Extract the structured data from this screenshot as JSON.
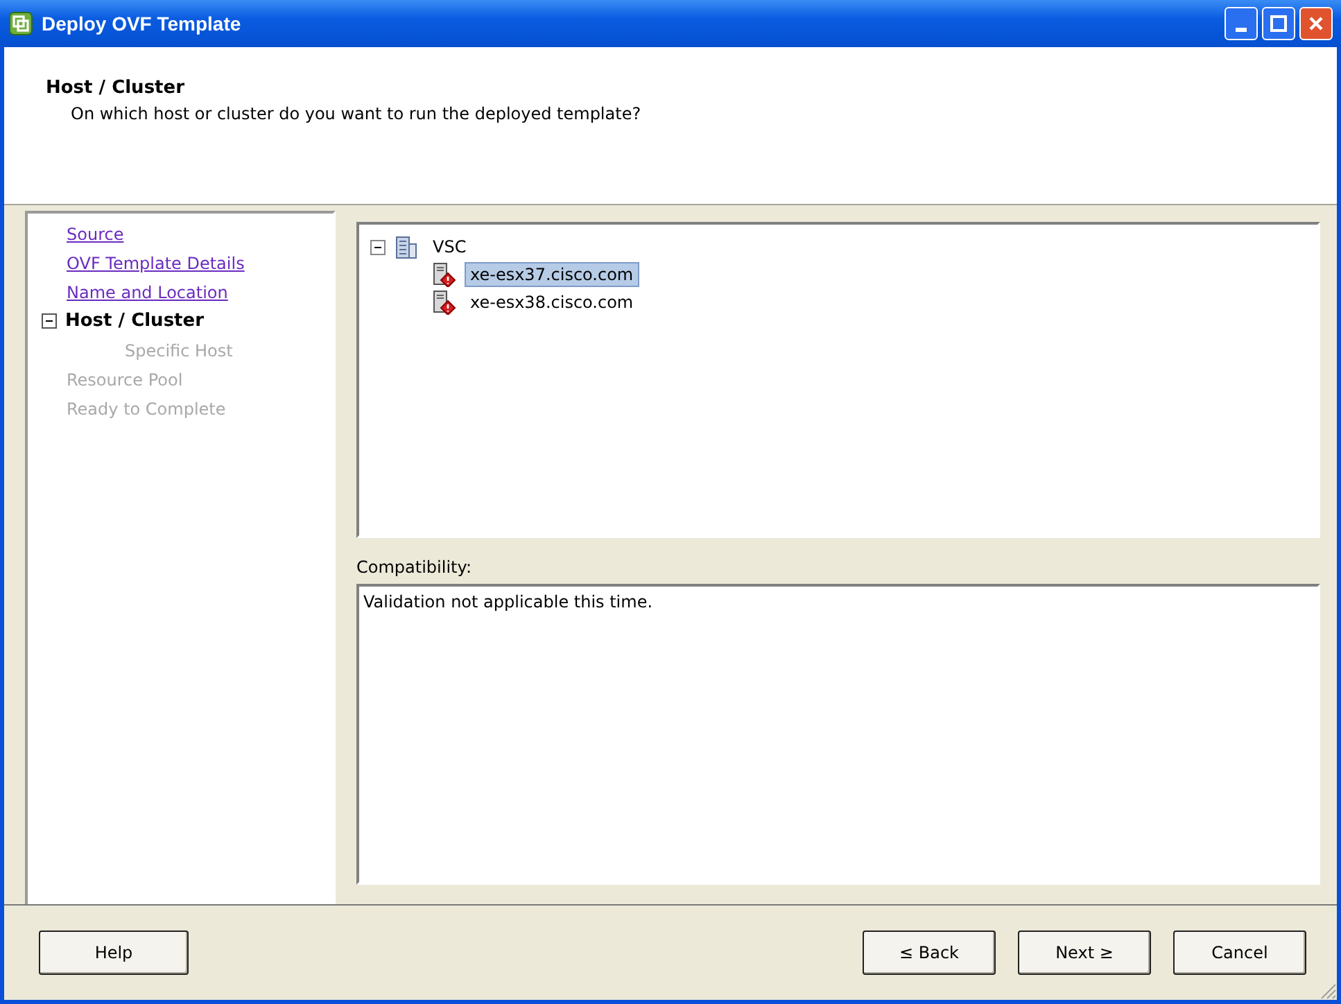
{
  "window": {
    "title": "Deploy OVF Template"
  },
  "header": {
    "title": "Host / Cluster",
    "subtitle": "On which host or cluster do you want to run the deployed template?"
  },
  "steps": [
    {
      "label": "Source",
      "kind": "link"
    },
    {
      "label": "OVF Template Details",
      "kind": "link"
    },
    {
      "label": "Name and Location",
      "kind": "link"
    },
    {
      "label": "Host / Cluster",
      "kind": "current",
      "expanded": true,
      "children": [
        {
          "label": "Specific Host",
          "kind": "pending"
        }
      ]
    },
    {
      "label": "Resource Pool",
      "kind": "pending"
    },
    {
      "label": "Ready to Complete",
      "kind": "pending"
    }
  ],
  "tree": [
    {
      "label": "VSC",
      "kind": "cluster",
      "expanded": true,
      "selected": false,
      "children": [
        {
          "label": "xe-esx37.cisco.com",
          "kind": "host",
          "selected": true
        },
        {
          "label": "xe-esx38.cisco.com",
          "kind": "host",
          "selected": false
        }
      ]
    }
  ],
  "compatibility": {
    "label": "Compatibility:",
    "text": "Validation not applicable this time."
  },
  "buttons": [
    {
      "label": "Help",
      "kind": "help"
    },
    {
      "label": "≤ Back",
      "kind": "nav"
    },
    {
      "label": "Next ≥",
      "kind": "nav"
    },
    {
      "label": "Cancel",
      "kind": "nav"
    }
  ]
}
